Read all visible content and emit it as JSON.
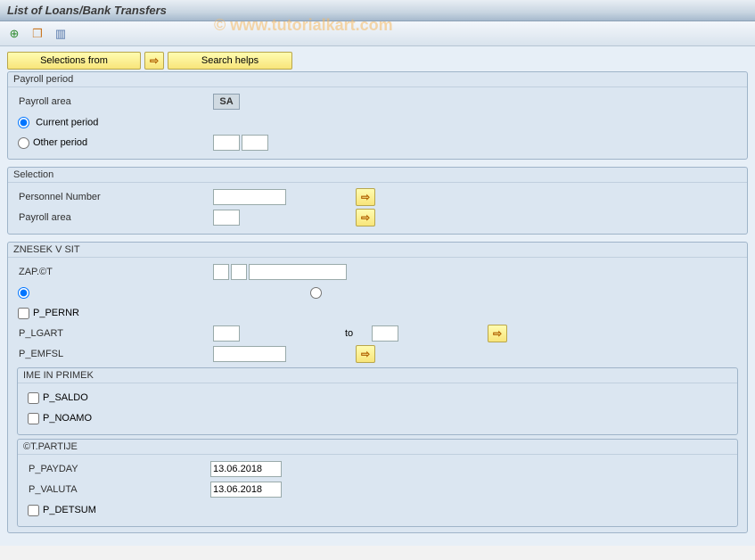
{
  "title": "List of Loans/Bank Transfers",
  "watermark": "© www.tutorialkart.com",
  "toolbar": {
    "selections_from": "Selections from",
    "search_helps": "Search helps"
  },
  "group_payroll": {
    "title": "Payroll period",
    "payroll_area_label": "Payroll area",
    "payroll_area_value": "SA",
    "current_period_label": "Current period",
    "other_period_label": "Other period",
    "other_from": "",
    "other_to": ""
  },
  "group_selection": {
    "title": "Selection",
    "pernr_label": "Personnel Number",
    "pernr_value": "",
    "area_label": "Payroll area",
    "area_value": ""
  },
  "group_znesek": {
    "title": "ZNESEK V SIT",
    "zap_label": "ZAP.©T",
    "zap_v1": "",
    "zap_v2": "",
    "zap_v3": "",
    "p_pernr_label": "P_PERNR",
    "p_lgart_label": "P_LGART",
    "p_lgart_from": "",
    "p_lgart_to_label": "to",
    "p_lgart_to": "",
    "p_emfsl_label": "P_EMFSL",
    "p_emfsl_value": "",
    "inner_ime": {
      "title": "IME IN PRIMEK",
      "p_saldo_label": "P_SALDO",
      "p_noamo_label": "P_NOAMO"
    },
    "inner_part": {
      "title": "©T.PARTIJE",
      "p_payday_label": "P_PAYDAY",
      "p_payday_value": "13.06.2018",
      "p_valuta_label": "P_VALUTA",
      "p_valuta_value": "13.06.2018",
      "p_detsum_label": "P_DETSUM"
    }
  }
}
